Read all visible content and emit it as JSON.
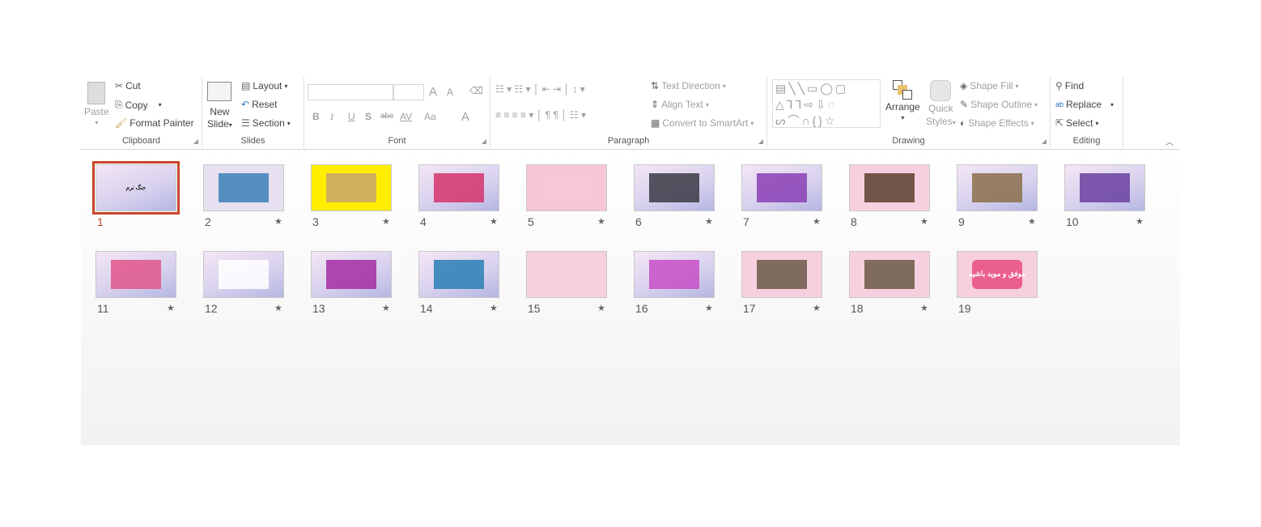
{
  "ribbon": {
    "clipboard": {
      "label": "Clipboard",
      "paste": "Paste",
      "cut": "Cut",
      "copy": "Copy",
      "format_painter": "Format Painter"
    },
    "slides": {
      "label": "Slides",
      "new_slide_1": "New",
      "new_slide_2": "Slide",
      "layout": "Layout",
      "reset": "Reset",
      "section": "Section"
    },
    "font": {
      "label": "Font",
      "bold": "B",
      "italic": "I",
      "underline": "U",
      "shadow": "S",
      "strike": "abc",
      "spacing": "AV",
      "case": "Aa",
      "color": "A",
      "grow": "A",
      "shrink": "A"
    },
    "paragraph": {
      "label": "Paragraph",
      "text_direction": "Text Direction",
      "align_text": "Align Text",
      "convert_smartart": "Convert to SmartArt"
    },
    "drawing": {
      "label": "Drawing",
      "arrange": "Arrange",
      "quick_styles_1": "Quick",
      "quick_styles_2": "Styles",
      "shape_fill": "Shape Fill",
      "shape_outline": "Shape Outline",
      "shape_effects": "Shape Effects"
    },
    "editing": {
      "label": "Editing",
      "find": "Find",
      "replace": "Replace",
      "select": "Select"
    }
  },
  "slides": [
    {
      "n": "1",
      "title": "جنگ نرم",
      "selected": true,
      "bg": "#e8dff3",
      "transition": false
    },
    {
      "n": "2",
      "bg": "#e6e0f0",
      "transition": true,
      "accent": "#3c7fb8"
    },
    {
      "n": "3",
      "bg": "#ffee00",
      "transition": true,
      "accent": "#c9a56b"
    },
    {
      "n": "4",
      "bg": "#e8dff3",
      "transition": true,
      "accent": "#d6336c"
    },
    {
      "n": "5",
      "bg": "#f7c5d8",
      "transition": true,
      "accent": "#f7c5d8"
    },
    {
      "n": "6",
      "bg": "#e8dff3",
      "transition": true,
      "accent": "#3a3a44"
    },
    {
      "n": "7",
      "bg": "#e8dff3",
      "transition": true,
      "accent": "#8a3fb5"
    },
    {
      "n": "8",
      "bg": "#f7d0df",
      "transition": true,
      "accent": "#5a4030"
    },
    {
      "n": "9",
      "bg": "#e8dff3",
      "transition": true,
      "accent": "#8a6f4b"
    },
    {
      "n": "10",
      "bg": "#e8dff3",
      "transition": true,
      "accent": "#6a3fa0"
    },
    {
      "n": "11",
      "bg": "#e8dff3",
      "transition": true,
      "accent": "#e0558a"
    },
    {
      "n": "12",
      "bg": "#e8dff3",
      "transition": true,
      "accent": "#ffffff"
    },
    {
      "n": "13",
      "bg": "#e8dff3",
      "transition": true,
      "accent": "#a32ea5"
    },
    {
      "n": "14",
      "bg": "#e8dff3",
      "transition": true,
      "accent": "#2a7fb5"
    },
    {
      "n": "15",
      "bg": "#f7d0df",
      "transition": true,
      "accent": "#f7d0df"
    },
    {
      "n": "16",
      "bg": "#e8dff3",
      "transition": true,
      "accent": "#c84fc8"
    },
    {
      "n": "17",
      "bg": "#f7d0df",
      "transition": true,
      "accent": "#6a5a48"
    },
    {
      "n": "18",
      "bg": "#f7d0df",
      "transition": true,
      "accent": "#6a5a48"
    },
    {
      "n": "19",
      "title": "موفق و موید باشید",
      "bg": "#f7d0df",
      "transition": false,
      "accent": "#e84b7e"
    }
  ],
  "colors": {
    "selection": "#c8462a",
    "star": "#666666"
  }
}
